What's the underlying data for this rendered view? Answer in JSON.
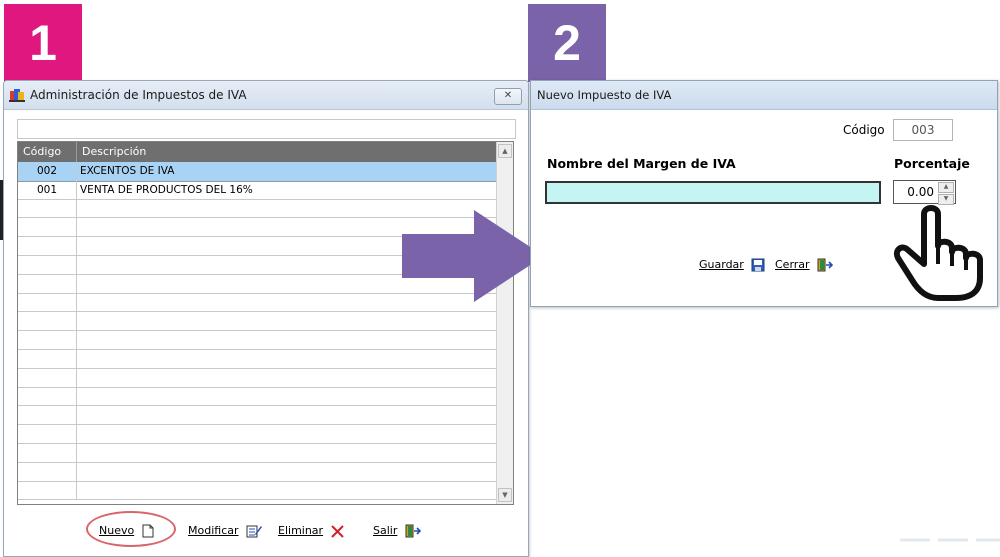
{
  "steps": [
    "1",
    "2"
  ],
  "window1": {
    "title": "Administración de Impuestos de IVA",
    "close_label": "✕",
    "columns": [
      "Código",
      "Descripción"
    ],
    "rows": [
      {
        "code": "002",
        "desc": "EXCENTOS DE IVA",
        "selected": true
      },
      {
        "code": "001",
        "desc": "VENTA DE PRODUCTOS DEL 16%",
        "selected": false
      }
    ],
    "empty_rows": 16,
    "buttons": {
      "new": "Nuevo",
      "modify": "Modificar",
      "delete": "Eliminar",
      "exit": "Salir"
    }
  },
  "window2": {
    "title": "Nuevo Impuesto de IVA",
    "code_label": "Código",
    "code_value": "003",
    "name_label": "Nombre del Margen de IVA",
    "name_value": "",
    "percent_label": "Porcentaje",
    "percent_value": "0.00",
    "save_label": "Guardar",
    "close_label": "Cerrar"
  },
  "colors": {
    "badge1": "#e0177f",
    "badge2": "#7a63a8",
    "arrow": "#7a63a8",
    "selected_row": "#a9d3f5",
    "input_fill": "#c5f5f3"
  }
}
